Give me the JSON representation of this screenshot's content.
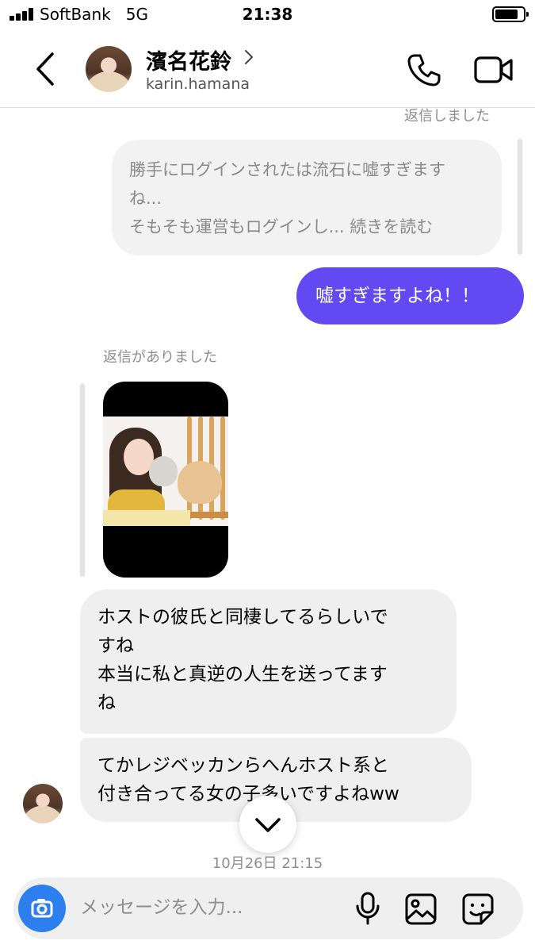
{
  "status_bar": {
    "carrier": "SoftBank",
    "network": "5G",
    "time": "21:38",
    "battery_level": 0.8
  },
  "header": {
    "name": "濱名花鈴",
    "handle": "karin.hamana",
    "icons": [
      "back-icon",
      "chevron-right-icon",
      "phone-icon",
      "video-camera-icon"
    ]
  },
  "messages": {
    "faded_label": "返信しました",
    "quoted": {
      "line1": "勝手にログインされたは流石に嘘すぎます",
      "line2": "ね...",
      "line3": "そもそも運営もログインし... 続きを読む"
    },
    "sent": "嘘すぎますよね！！",
    "reply_label": "返信がありました",
    "received": [
      {
        "line1": "ホストの彼氏と同棲してるらしいで",
        "line2": "すね",
        "line3": "本当に私と真逆の人生を送ってます",
        "line4": "ね"
      },
      {
        "line1": "てかレジベッカンらへんホスト系と",
        "line2": "付き合ってる女の子多いですよねww"
      }
    ],
    "timestamp": "10月26日 21:15"
  },
  "composer": {
    "placeholder": "メッセージを入力...",
    "icons": [
      "camera-icon",
      "microphone-icon",
      "image-icon",
      "sticker-icon"
    ]
  },
  "colors": {
    "accent": "#6349f2",
    "bubble_gray": "#efefef",
    "camera_blue": "#2d7ff0",
    "muted_text": "#8e8e8e"
  }
}
